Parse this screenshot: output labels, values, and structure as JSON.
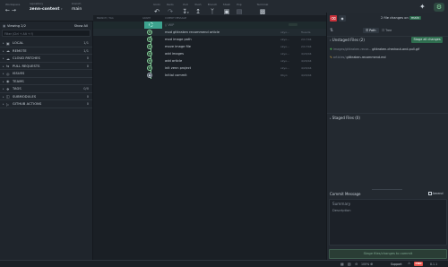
{
  "toolbar": {
    "workspace_label": "Workspace",
    "repository_label": "repository",
    "repository_value": "zenn-content",
    "branch_label": "branch",
    "branch_value": "main",
    "undo": "Undo",
    "redo": "Redo",
    "pull": "Pull",
    "push": "Push",
    "branch": "Branch",
    "stash": "Stash",
    "pop": "Pop",
    "terminal": "Terminal"
  },
  "left": {
    "viewing": "Viewing 2/2",
    "show_all": "Show All",
    "filter_placeholder": "Filter (Ctrl + Alt + f)",
    "sections": [
      {
        "name": "LOCAL",
        "count": "1/1"
      },
      {
        "name": "REMOTE",
        "count": "1/1"
      },
      {
        "name": "CLOUD PATCHES",
        "count": "0"
      },
      {
        "name": "PULL REQUESTS",
        "count": "0"
      },
      {
        "name": "ISSUES",
        "count": ""
      },
      {
        "name": "TEAMS",
        "count": ""
      },
      {
        "name": "TAGS",
        "count": "0/0"
      },
      {
        "name": "SUBMODULES",
        "count": "0"
      },
      {
        "name": "GITHUB ACTIONS",
        "count": "0"
      }
    ]
  },
  "graph": {
    "branch_tag": "main",
    "header_branch": "BRANCH / TAG",
    "header_graph": "GRAPH",
    "header_message": "COMMIT MESSAGE",
    "wip": "// WIP",
    "commits": [
      {
        "message": "mod gitkraken recommend article",
        "author": "okyo...",
        "date": "Tuesda"
      },
      {
        "message": "mod image path",
        "author": "okyo...",
        "date": "2/17/44"
      },
      {
        "message": "move image file",
        "author": "okyo...",
        "date": "2/17/44"
      },
      {
        "message": "add images",
        "author": "okyo...",
        "date": "4/29/44"
      },
      {
        "message": "add article",
        "author": "okyo...",
        "date": "4/29/44"
      },
      {
        "message": "init zenn project",
        "author": "okyo...",
        "date": "4/29/44"
      },
      {
        "message": "Initial commit",
        "author": "Okyo",
        "date": "4/29/44"
      }
    ]
  },
  "right": {
    "file_changes": "2 file changes on",
    "branch": "main",
    "path_tab": "Path",
    "tree_tab": "Tree",
    "unstaged_title": "Unstaged Files (2)",
    "stage_all": "Stage all changes",
    "files": [
      {
        "path": "images/gitkraken-recor...",
        "name": "gitkraken-checkout-and-pull.gif",
        "kind": "added"
      },
      {
        "path": "articles/",
        "name": "gitkraken-recommend.md",
        "kind": "modified"
      }
    ],
    "staged_title": "Staged Files (0)",
    "commit_message_label": "Commit Message",
    "amend_label": "Amend",
    "summary_placeholder": "Summary",
    "description_placeholder": "Description",
    "commit_button": "Stage files/changes to commit"
  },
  "status": {
    "zoom": "100%",
    "support": "Support",
    "pro": "PRO",
    "version": "8.1.1"
  },
  "colors": {
    "accent_green": "#4caf50",
    "graph_green": "#8ad7a0",
    "pro_red": "#e5534b",
    "teal": "#3da38f"
  }
}
